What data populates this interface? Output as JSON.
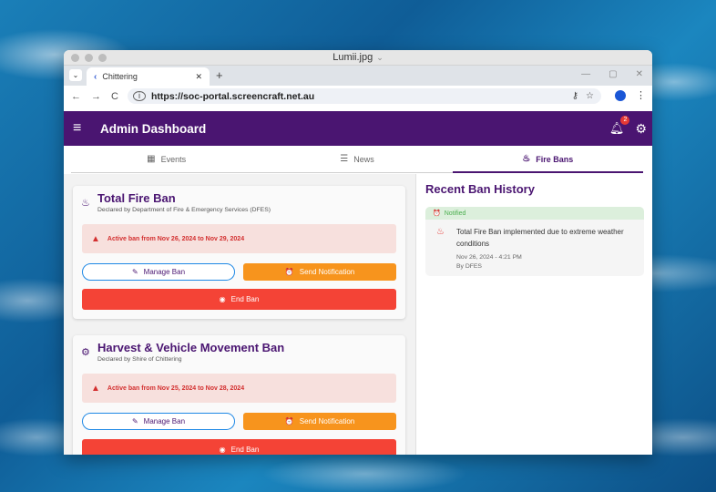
{
  "window": {
    "title": "Lumii.jpg"
  },
  "browser": {
    "tab_label": "Chittering",
    "url": "https://soc-portal.screencraft.net.au"
  },
  "appbar": {
    "title": "Admin Dashboard",
    "notification_count": "2"
  },
  "tabs": [
    {
      "label": "Events",
      "icon": "calendar-icon"
    },
    {
      "label": "News",
      "icon": "newspaper-icon"
    },
    {
      "label": "Fire Bans",
      "icon": "flame-icon",
      "active": true
    }
  ],
  "bans": [
    {
      "title": "Total Fire Ban",
      "declared": "Declared by Department of Fire & Emergency Services (DFES)",
      "alert": "Active ban from Nov 26, 2024 to Nov 29, 2024",
      "manage_label": "Manage Ban",
      "notify_label": "Send Notification",
      "end_label": "End Ban"
    },
    {
      "title": "Harvest & Vehicle Movement Ban",
      "declared": "Declared by Shire of Chittering",
      "alert": "Active ban from Nov 25, 2024 to Nov 28, 2024",
      "manage_label": "Manage Ban",
      "notify_label": "Send Notification",
      "end_label": "End Ban"
    }
  ],
  "history": {
    "title": "Recent Ban History",
    "items": [
      {
        "status": "Notified",
        "text": "Total Fire Ban implemented due to extreme weather conditions",
        "date": "Nov 26, 2024 - 4:21 PM",
        "by": "By DFES"
      }
    ]
  },
  "colors": {
    "primary": "#4a1571",
    "alert_bg": "#f7e0dd",
    "alert_text": "#d32f2f",
    "notify": "#f7941d",
    "end": "#f44336",
    "notified": "#4caf50"
  }
}
